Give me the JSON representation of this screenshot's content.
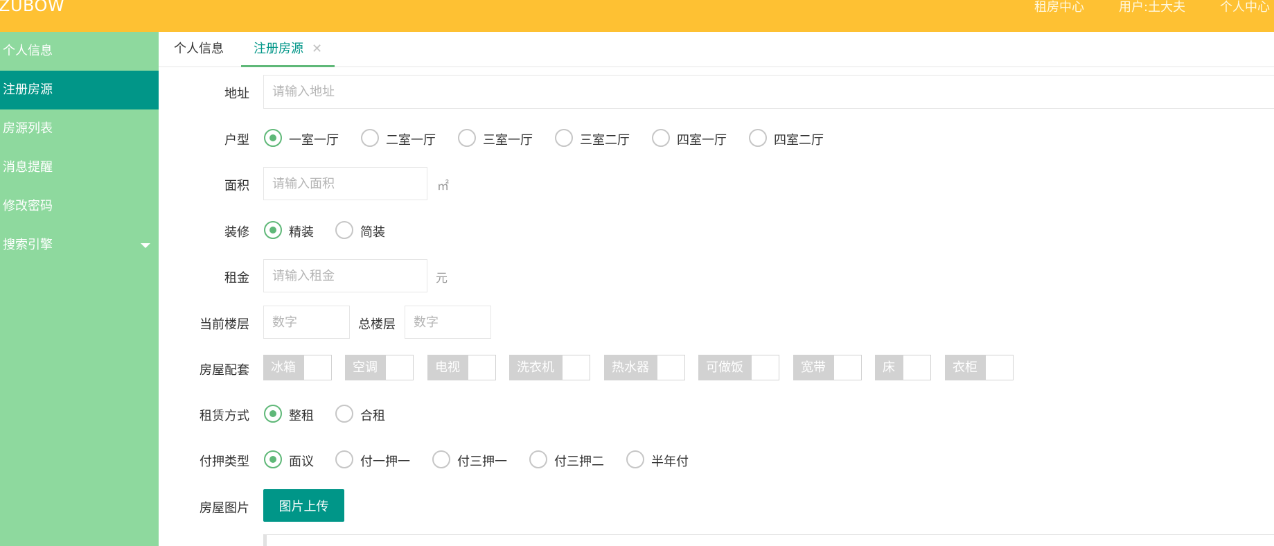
{
  "header": {
    "logo": "ZUBOW",
    "nav": [
      "租房中心",
      "用户:土大夫",
      "个人中心"
    ]
  },
  "sidebar": {
    "items": [
      {
        "label": "个人信息"
      },
      {
        "label": "注册房源"
      },
      {
        "label": "房源列表"
      },
      {
        "label": "消息提醒"
      },
      {
        "label": "修改密码"
      },
      {
        "label": "搜索引擎"
      }
    ]
  },
  "tabs": [
    {
      "label": "个人信息"
    },
    {
      "label": "注册房源",
      "close": "✕"
    }
  ],
  "form": {
    "address": {
      "label": "地址",
      "placeholder": "请输入地址"
    },
    "layout": {
      "label": "户型",
      "options": [
        "一室一厅",
        "二室一厅",
        "三室一厅",
        "三室二厅",
        "四室一厅",
        "四室二厅"
      ],
      "selected": "一室一厅"
    },
    "area": {
      "label": "面积",
      "placeholder": "请输入面积",
      "unit": "㎡"
    },
    "decoration": {
      "label": "装修",
      "options": [
        "精装",
        "简装"
      ],
      "selected": "精装"
    },
    "rent": {
      "label": "租金",
      "placeholder": "请输入租金",
      "unit": "元"
    },
    "floor": {
      "current_label": "当前楼层",
      "current_placeholder": "数字",
      "total_label": "总楼层",
      "total_placeholder": "数字"
    },
    "facilities": {
      "label": "房屋配套",
      "options": [
        "冰箱",
        "空调",
        "电视",
        "洗衣机",
        "热水器",
        "可做饭",
        "宽带",
        "床",
        "衣柜"
      ]
    },
    "lease": {
      "label": "租赁方式",
      "options": [
        "整租",
        "合租"
      ],
      "selected": "整租"
    },
    "payment": {
      "label": "付押类型",
      "options": [
        "面议",
        "付一押一",
        "付三押一",
        "付三押二",
        "半年付"
      ],
      "selected": "面议"
    },
    "images": {
      "label": "房屋图片",
      "upload_label": "图片上传"
    }
  },
  "colors": {
    "header_bg": "#fec133",
    "sidebar_bg": "#8ed99e",
    "sidebar_active": "#019688",
    "primary_button": "#009688",
    "radio_checked": "#5fb878",
    "checkbox_label_bg": "#d2d2d2"
  }
}
